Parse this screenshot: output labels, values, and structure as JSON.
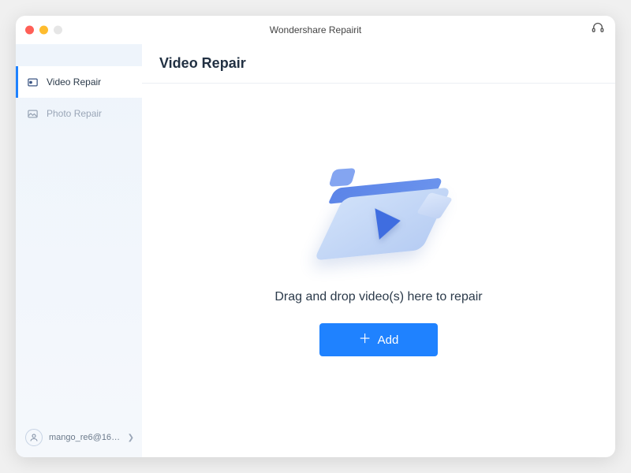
{
  "app_title": "Wondershare Repairit",
  "page_title": "Video Repair",
  "sidebar": {
    "items": [
      {
        "label": "Video Repair",
        "active": true
      },
      {
        "label": "Photo Repair",
        "active": false
      }
    ]
  },
  "user": {
    "display_name": "mango_re6@163...."
  },
  "dropzone": {
    "instruction": "Drag and drop video(s) here to repair",
    "add_label": "Add"
  }
}
